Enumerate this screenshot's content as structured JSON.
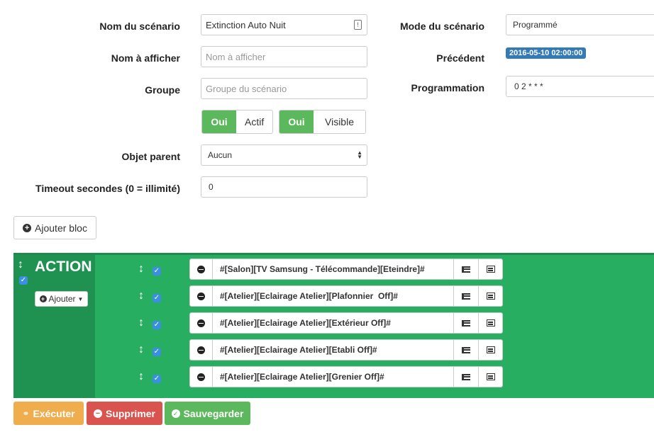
{
  "form": {
    "scenario_name_label": "Nom du scénario",
    "scenario_name_value": "Extinction Auto Nuit",
    "display_name_label": "Nom à afficher",
    "display_name_placeholder": "Nom à afficher",
    "group_label": "Groupe",
    "group_placeholder": "Groupe du scénario",
    "active_toggle": {
      "on_label": "Oui",
      "off_label": "Actif"
    },
    "visible_toggle": {
      "on_label": "Oui",
      "off_label": "Visible"
    },
    "parent_object_label": "Objet parent",
    "parent_object_value": "Aucun",
    "timeout_label": "Timeout secondes (0 = illimité)",
    "timeout_value": "0"
  },
  "right_panel": {
    "mode_label": "Mode du scénario",
    "mode_value": "Programmé",
    "previous_label": "Précédent",
    "previous_value": "2016-05-10 02:00:00",
    "schedule_label": "Programmation",
    "schedule_value": "0 2 * * *"
  },
  "add_block_label": "Ajouter bloc",
  "action_block": {
    "title": "ACTION",
    "add_label": "Ajouter",
    "commands": [
      "#[Salon][TV Samsung - Télécommande][Eteindre]#",
      "#[Atelier][Eclairage Atelier][Plafonnier  Off]#",
      "#[Atelier][Eclairage Atelier][Extérieur Off]#",
      "#[Atelier][Eclairage Atelier][Etabli Off]#",
      "#[Atelier][Eclairage Atelier][Grenier Off]#"
    ]
  },
  "footer": {
    "execute_label": "Exécuter",
    "delete_label": "Supprimer",
    "save_label": "Sauvegarder"
  },
  "colors": {
    "success": "#5cb85c",
    "warning": "#f0ad4e",
    "danger": "#d9534f",
    "primary": "#337ab7",
    "block_green": "#27ae60",
    "block_dark": "#1f9150"
  }
}
